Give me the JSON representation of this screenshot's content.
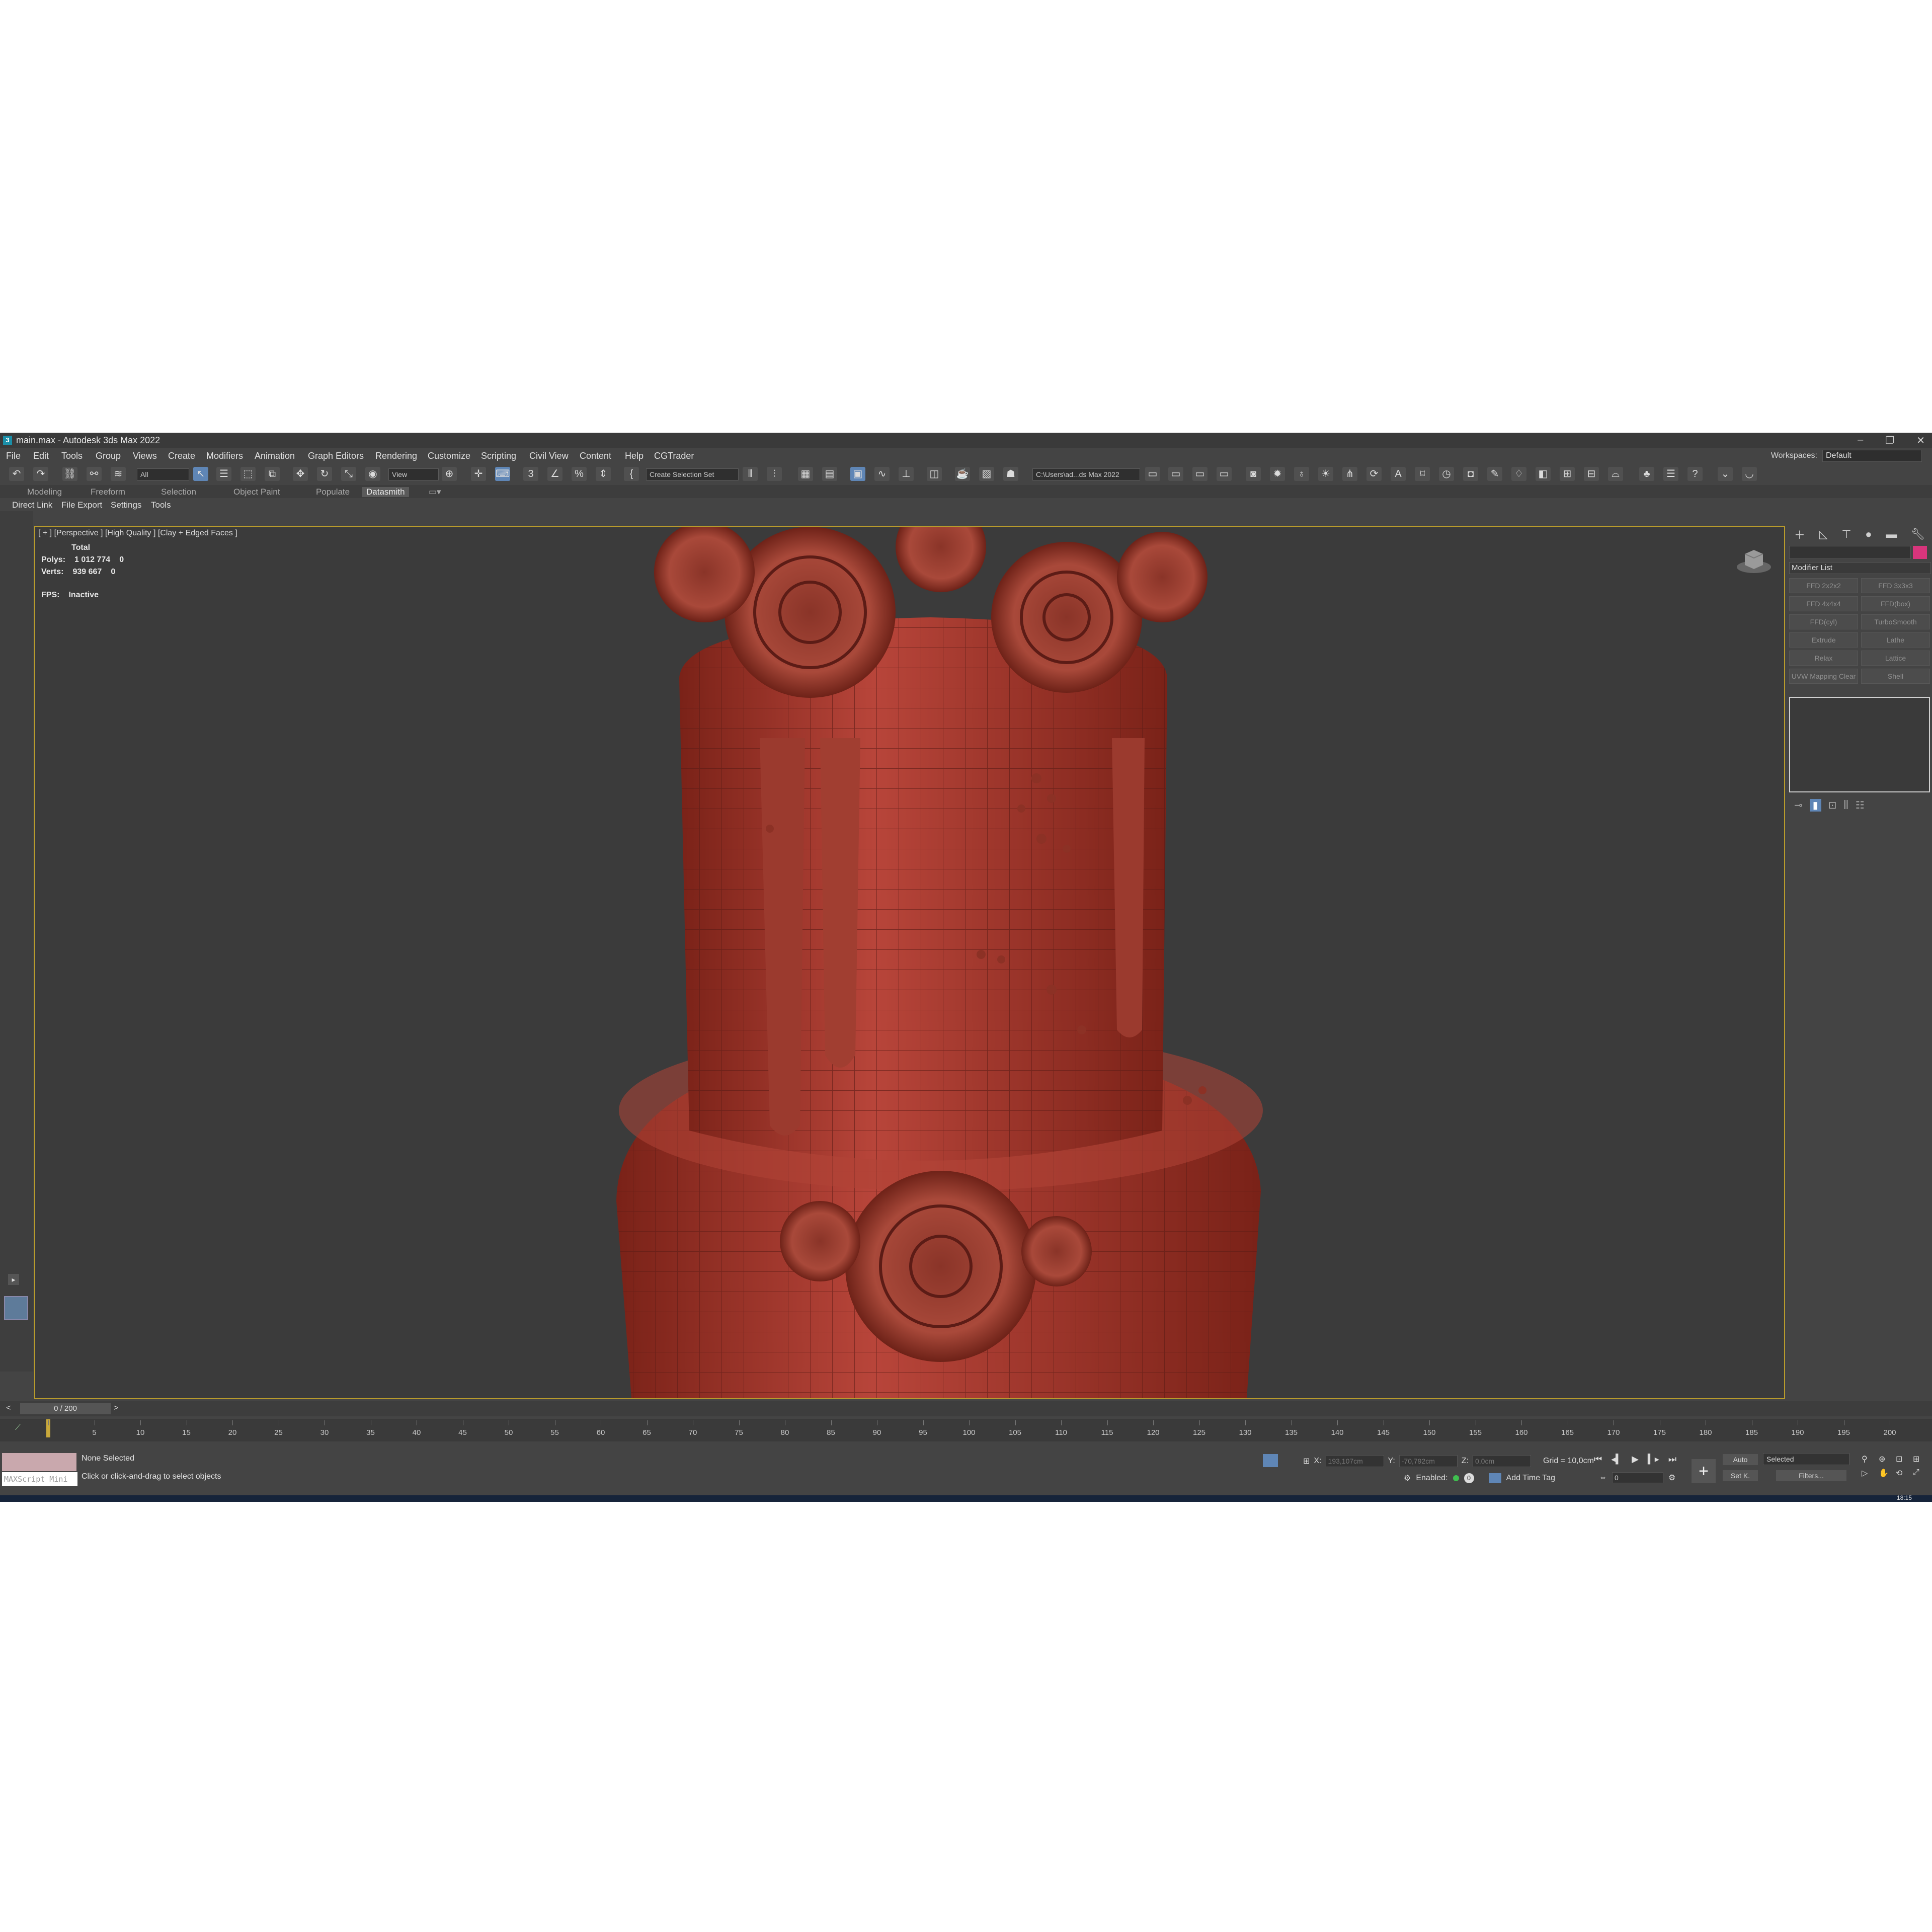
{
  "window": {
    "title": "main.max - Autodesk 3ds Max 2022",
    "logo": "3"
  },
  "menu": [
    "File",
    "Edit",
    "Tools",
    "Group",
    "Views",
    "Create",
    "Modifiers",
    "Animation",
    "Graph Editors",
    "Rendering",
    "Customize",
    "Scripting",
    "Civil View",
    "Content",
    "Help",
    "CGTrader"
  ],
  "workspaces": {
    "label": "Workspaces:",
    "value": "Default"
  },
  "toolbar": {
    "filter_value": "All",
    "refcoord_value": "View",
    "selection_set_placeholder": "Create Selection Set",
    "path_value": "C:\\Users\\ad...ds Max 2022"
  },
  "ribbon_tabs": [
    "Modeling",
    "Freeform",
    "Selection",
    "Object Paint",
    "Populate",
    "Datasmith"
  ],
  "ribbon_active": "Datasmith",
  "subtabs": [
    "Direct Link",
    "File Export",
    "Settings",
    "Tools"
  ],
  "viewport": {
    "label": "[ + ] [Perspective ] [High Quality ] [Clay + Edged Faces ]",
    "total_label": "Total",
    "polys_label": "Polys:",
    "polys_value": "1 012 774",
    "polys_sel": "0",
    "verts_label": "Verts:",
    "verts_value": "939 667",
    "verts_sel": "0",
    "fps_label": "FPS:",
    "fps_value": "Inactive"
  },
  "command_panel": {
    "modifier_list": "Modifier List",
    "swatch_color": "#d8357c",
    "modifiers": [
      "FFD 2x2x2",
      "FFD 3x3x3",
      "FFD 4x4x4",
      "FFD(box)",
      "FFD(cyl)",
      "TurboSmooth",
      "Extrude",
      "Lathe",
      "Relax",
      "Lattice",
      "UVW Mapping Clear",
      "Shell"
    ]
  },
  "timeline": {
    "slider_label": "0 / 200",
    "current_frame": 0,
    "ticks": [
      0,
      5,
      10,
      15,
      20,
      25,
      30,
      35,
      40,
      45,
      50,
      55,
      60,
      65,
      70,
      75,
      80,
      85,
      90,
      95,
      100,
      105,
      110,
      115,
      120,
      125,
      130,
      135,
      140,
      145,
      150,
      155,
      160,
      165,
      170,
      175,
      180,
      185,
      190,
      195,
      200
    ]
  },
  "status": {
    "maxscript_placeholder": "MAXScript Mini",
    "selection": "None Selected",
    "prompt": "Click or click-and-drag to select objects",
    "x_label": "X:",
    "x_value": "193,107cm",
    "y_label": "Y:",
    "y_value": "-70,792cm",
    "z_label": "Z:",
    "z_value": "0,0cm",
    "grid": "Grid = 10,0cm",
    "enabled": "Enabled:",
    "add_time_tag": "Add Time Tag",
    "auto": "Auto",
    "selected": "Selected",
    "setk": "Set K.",
    "filters": "Filters...",
    "frame_value": "0"
  },
  "clock": "18:15"
}
